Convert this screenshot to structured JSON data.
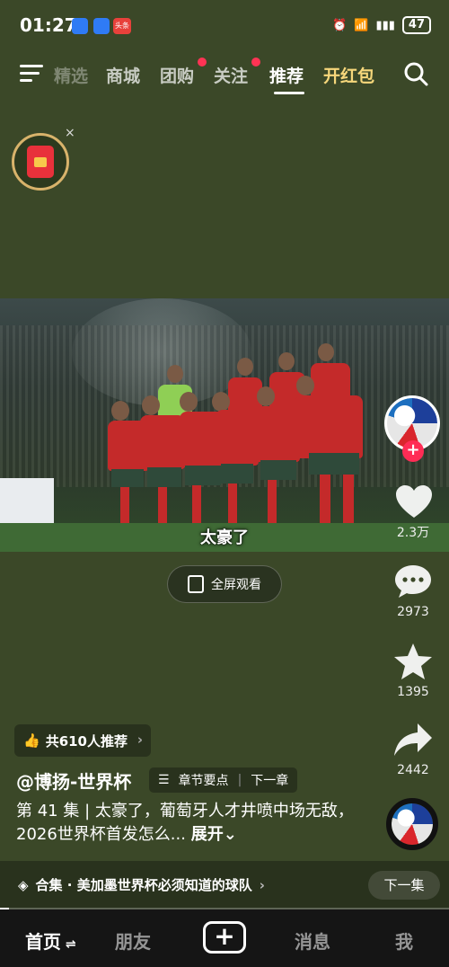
{
  "status_bar": {
    "time": "01:27",
    "mini_apps": [
      "app-icon-blue-1",
      "app-icon-blue-2",
      "头条"
    ],
    "battery": "47",
    "signal_label": "6"
  },
  "top_tabs": {
    "items": [
      {
        "label": "精选",
        "state": "faded"
      },
      {
        "label": "商城",
        "state": "normal"
      },
      {
        "label": "团购",
        "state": "normal",
        "dot": true
      },
      {
        "label": "关注",
        "state": "normal",
        "dot": true
      },
      {
        "label": "推荐",
        "state": "active"
      },
      {
        "label": "开红包",
        "state": "gold"
      }
    ]
  },
  "video": {
    "subtitle": "太豪了",
    "fullscreen_label": "全屏观看"
  },
  "rail": {
    "likes": "2.3万",
    "comments": "2973",
    "favorites": "1395",
    "shares": "2442"
  },
  "info": {
    "recommend": "共610人推荐",
    "author": "@博扬-世界杯",
    "chapter_points": "章节要点",
    "next_chapter": "下一章",
    "description": "第 41 集 | 太豪了，葡萄牙人才井喷中场无敌，2026世界杯首发怎么...",
    "expand": "展开"
  },
  "collection": {
    "label": "合集 · 美加墨世界杯必须知道的球队",
    "next_episode": "下一集",
    "progress": 0.02
  },
  "bottom_nav": {
    "home": "首页",
    "friends": "朋友",
    "messages": "消息",
    "me": "我"
  },
  "colors": {
    "background": "#3b4828",
    "accent_red": "#ff2c55",
    "gold": "#f6d77b"
  }
}
